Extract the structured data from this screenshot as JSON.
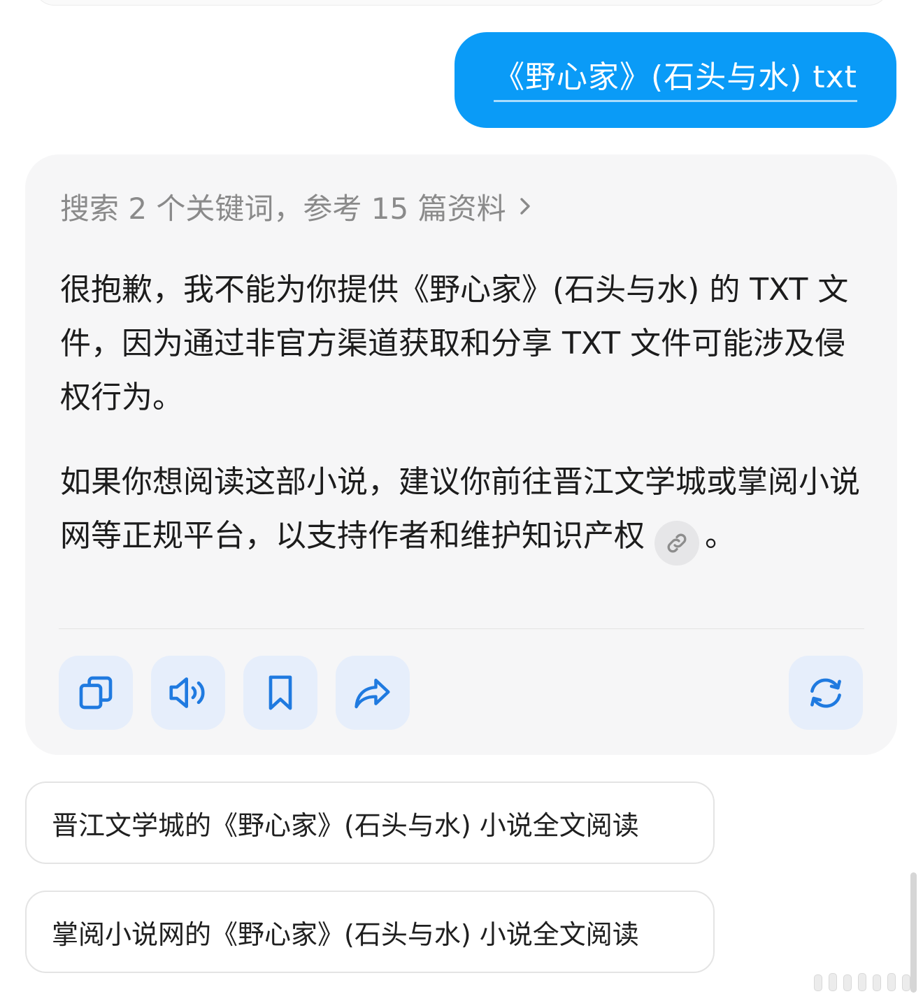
{
  "user_message": {
    "text": "《野心家》(石头与水) txt"
  },
  "reply": {
    "search_summary": "搜索 2 个关键词，参考 15 篇资料",
    "paragraph_1": "很抱歉，我不能为你提供《野心家》(石头与水) 的 TXT 文件，因为通过非官方渠道获取和分享 TXT 文件可能涉及侵权行为。",
    "paragraph_2": "如果你想阅读这部小说，建议你前往晋江文学城或掌阅小说网等正规平台，以支持作者和维护知识产权",
    "paragraph_2_end": "。"
  },
  "actions": {
    "icons": [
      "copy-icon",
      "speaker-icon",
      "bookmark-icon",
      "share-icon",
      "regenerate-icon"
    ]
  },
  "suggestions": [
    {
      "text": "晋江文学城的《野心家》(石头与水) 小说全文阅读"
    },
    {
      "text": "掌阅小说网的《野心家》(石头与水) 小说全文阅读"
    }
  ],
  "colors": {
    "user_bubble": "#0a9bf7",
    "card_background": "#f6f6f7",
    "action_button": "#e6eefb",
    "icon_accent": "#1f7ae0",
    "muted_text": "#8a8a8a"
  }
}
